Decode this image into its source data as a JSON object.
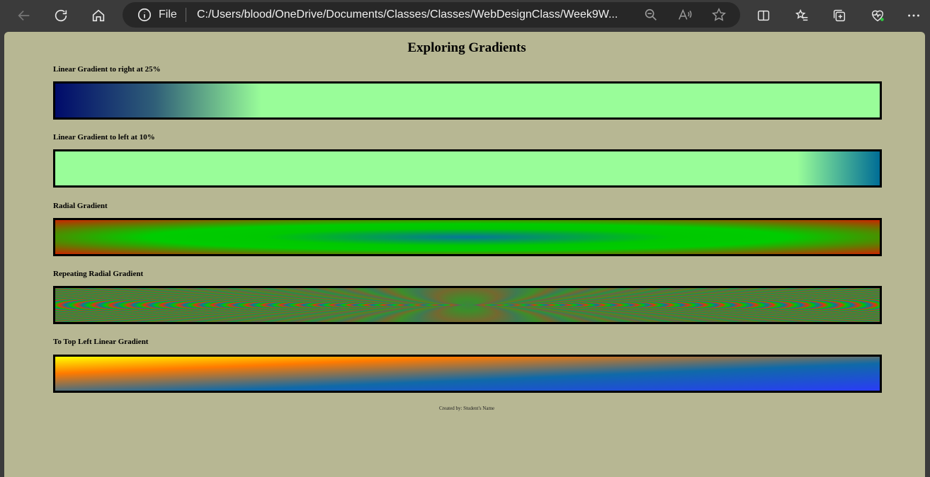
{
  "browser": {
    "address_label": "File",
    "url": "C:/Users/blood/OneDrive/Documents/Classes/Classes/WebDesignClass/Week9W..."
  },
  "page": {
    "title": "Exploring Gradients",
    "sections": [
      {
        "label": "Linear Gradient to right at 25%"
      },
      {
        "label": "Linear Gradient to left at 10%"
      },
      {
        "label": "Radial Gradient"
      },
      {
        "label": "Repeating Radial Gradient"
      },
      {
        "label": "To Top Left Linear Gradient"
      }
    ],
    "footer": "Created by: Student's Name"
  },
  "colors": {
    "page_background": "#b7b793",
    "green": "#99fd99",
    "navy": "#000b6a",
    "teal": "#006d96",
    "red": "#cc2400",
    "bright_green": "#00c800",
    "blue": "#2a3cf6",
    "orange": "#ff7a00",
    "yellow": "#ffff00"
  }
}
